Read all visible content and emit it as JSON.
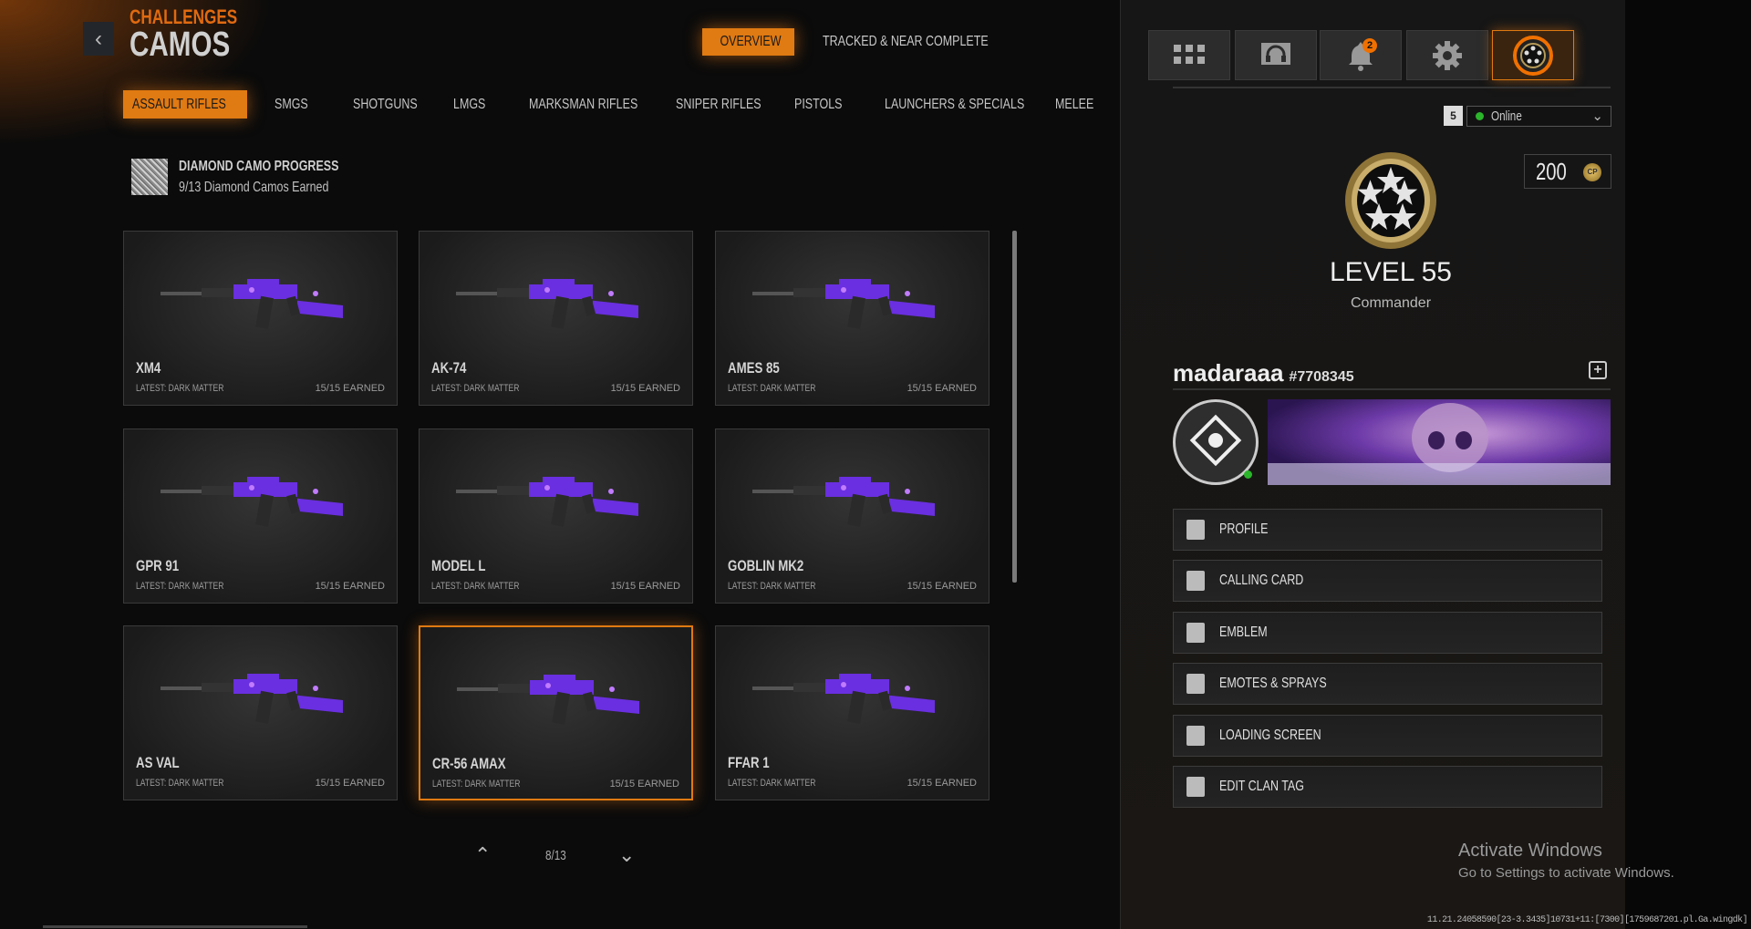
{
  "header": {
    "breadcrumb": "CHALLENGES",
    "title": "CAMOS",
    "back_icon": "chevron-left-icon"
  },
  "top_tabs": [
    {
      "label": "OVERVIEW",
      "active": true
    },
    {
      "label": "TRACKED & NEAR COMPLETE",
      "active": false
    }
  ],
  "categories": [
    {
      "label": "ASSAULT RIFLES",
      "active": true
    },
    {
      "label": "SMGS"
    },
    {
      "label": "SHOTGUNS"
    },
    {
      "label": "LMGS"
    },
    {
      "label": "MARKSMAN RIFLES"
    },
    {
      "label": "SNIPER RIFLES"
    },
    {
      "label": "PISTOLS"
    },
    {
      "label": "LAUNCHERS & SPECIALS"
    },
    {
      "label": "MELEE"
    }
  ],
  "diamond": {
    "title": "DIAMOND CAMO PROGRESS",
    "subtitle": "9/13 Diamond Camos Earned"
  },
  "weapons": [
    {
      "name": "XM4",
      "latest": "LATEST: DARK MATTER",
      "earned": "15/15 EARNED"
    },
    {
      "name": "AK-74",
      "latest": "LATEST: DARK MATTER",
      "earned": "15/15 EARNED"
    },
    {
      "name": "AMES 85",
      "latest": "LATEST: DARK MATTER",
      "earned": "15/15 EARNED"
    },
    {
      "name": "GPR 91",
      "latest": "LATEST: DARK MATTER",
      "earned": "15/15 EARNED"
    },
    {
      "name": "MODEL L",
      "latest": "LATEST: DARK MATTER",
      "earned": "15/15 EARNED"
    },
    {
      "name": "GOBLIN MK2",
      "latest": "LATEST: DARK MATTER",
      "earned": "15/15 EARNED"
    },
    {
      "name": "AS VAL",
      "latest": "LATEST: DARK MATTER",
      "earned": "15/15 EARNED"
    },
    {
      "name": "CR-56 AMAX",
      "latest": "LATEST: DARK MATTER",
      "earned": "15/15 EARNED",
      "selected": true
    },
    {
      "name": "FFAR 1",
      "latest": "LATEST: DARK MATTER",
      "earned": "15/15 EARNED"
    }
  ],
  "pagination": {
    "label": "8/13"
  },
  "nav": {
    "notifications_count": "2",
    "icons": [
      "grid-icon",
      "headset-chat-icon",
      "bell-icon",
      "gear-icon",
      "rank-avatar-icon"
    ]
  },
  "profile": {
    "party_size": "5",
    "status": "Online",
    "cod_points": "200",
    "cp_label": "CP",
    "level": "LEVEL 55",
    "rank_name": "Commander",
    "username": "madaraaa",
    "tag": "#7708345"
  },
  "menu": [
    {
      "label": "PROFILE",
      "icon": "phone-profile-icon"
    },
    {
      "label": "CALLING CARD",
      "icon": "calling-card-icon"
    },
    {
      "label": "EMBLEM",
      "icon": "emblem-icon"
    },
    {
      "label": "EMOTES & SPRAYS",
      "icon": "spray-can-icon"
    },
    {
      "label": "LOADING SCREEN",
      "icon": "loading-screen-icon"
    },
    {
      "label": "EDIT CLAN TAG",
      "icon": "clan-tag-icon"
    }
  ],
  "watermark": {
    "line1": "Activate Windows",
    "line2": "Go to Settings to activate Windows."
  },
  "debug": "11.21.24058590[23-3.3435]10731+11:[7300][1759687201.pl.Ga.wingdk]",
  "colors": {
    "accent": "#e07a12",
    "camo": "#6a2fe0",
    "online": "#2bb52b"
  }
}
